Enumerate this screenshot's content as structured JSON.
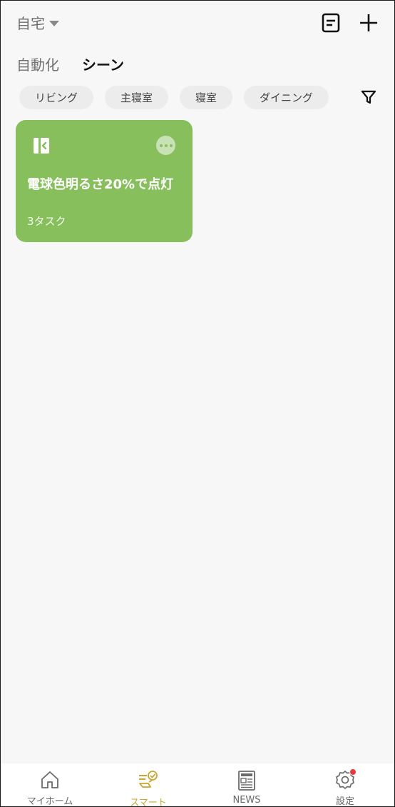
{
  "header": {
    "home_name": "自宅",
    "icons": {
      "log": "document-icon",
      "add": "plus-icon"
    }
  },
  "tabs": [
    {
      "label": "自動化",
      "active": false
    },
    {
      "label": "シーン",
      "active": true
    }
  ],
  "room_chips": [
    "リビング",
    "主寝室",
    "寝室",
    "ダイニング"
  ],
  "scene_card": {
    "color": "#86bf5c",
    "name": "電球色明るさ20%で点灯",
    "tasks": "3タスク"
  },
  "bottom_nav": [
    {
      "label": "マイホーム",
      "icon": "home-icon",
      "active": false
    },
    {
      "label": "スマート",
      "icon": "smart-icon",
      "active": true
    },
    {
      "label": "NEWS",
      "icon": "news-icon",
      "active": false
    },
    {
      "label": "設定",
      "icon": "settings-icon",
      "active": false,
      "badge": true
    }
  ],
  "colors": {
    "accent": "#c9a62e",
    "badge": "#e8393d"
  }
}
